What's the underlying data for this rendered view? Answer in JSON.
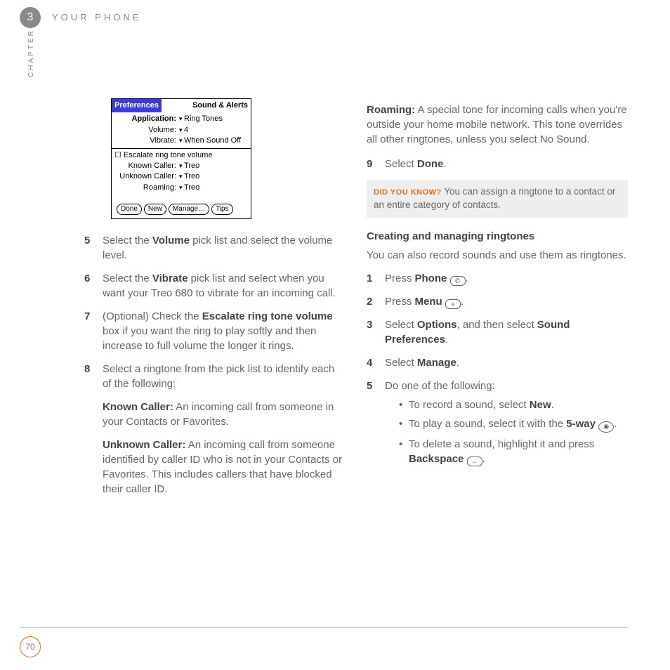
{
  "header": {
    "chapter_number": "3",
    "title": "YOUR PHONE",
    "side_label": "CHAPTER"
  },
  "prefs": {
    "tab": "Preferences",
    "category": "Sound & Alerts",
    "rows1": [
      {
        "label": "Application:",
        "value": "Ring Tones",
        "bold": true
      },
      {
        "label": "Volume:",
        "value": "4"
      },
      {
        "label": "Vibrate:",
        "value": "When Sound Off"
      }
    ],
    "checkbox": "Escalate ring tone volume",
    "rows2": [
      {
        "label": "Known Caller:",
        "value": "Treo"
      },
      {
        "label": "Unknown Caller:",
        "value": "Treo"
      },
      {
        "label": "Roaming:",
        "value": "Treo"
      }
    ],
    "buttons": [
      "Done",
      "New",
      "Manage…",
      "Tips"
    ]
  },
  "left_steps": [
    {
      "n": "5",
      "pre": "Select the ",
      "b": "Volume",
      "post": " pick list and select the volume level."
    },
    {
      "n": "6",
      "pre": "Select the ",
      "b": "Vibrate",
      "post": " pick list and select when you want your Treo 680 to vibrate for an incoming call."
    },
    {
      "n": "7",
      "pre": "(Optional)  Check the ",
      "b": "Escalate ring tone volume",
      "post": " box if you want the ring to play softly and then increase to full volume the longer it rings."
    },
    {
      "n": "8",
      "pre": "Select a ringtone from the pick list to identify each of the following:",
      "b": "",
      "post": ""
    }
  ],
  "defs": [
    {
      "term": "Known Caller:",
      "text": " An incoming call from someone in your Contacts or Favorites."
    },
    {
      "term": "Unknown Caller:",
      "text": " An incoming call from someone identified by caller ID who is not in your Contacts or Favorites. This includes callers that have blocked their caller ID."
    }
  ],
  "right": {
    "roaming_term": "Roaming:",
    "roaming_text": " A special tone for incoming calls when you're outside your home mobile network. This tone overrides all other ringtones, unless you select No Sound.",
    "step9_n": "9",
    "step9_pre": "Select ",
    "step9_b": "Done",
    "step9_post": ".",
    "callout_lead": "DID YOU KNOW?",
    "callout_text": "  You can assign a ringtone to a contact or an entire category of contacts.",
    "section_title": "Creating and managing ringtones",
    "section_intro": "You can also record sounds and use them as ringtones.",
    "steps": [
      {
        "n": "1",
        "pre": "Press ",
        "b": "Phone",
        "post": " ",
        "icon": "phone-icon",
        "tail": "."
      },
      {
        "n": "2",
        "pre": "Press ",
        "b": "Menu",
        "post": " ",
        "icon": "menu-icon",
        "tail": "."
      },
      {
        "n": "3",
        "pre": "Select ",
        "b": "Options",
        "post": ", and then select ",
        "b2": "Sound Preferences",
        "tail": "."
      },
      {
        "n": "4",
        "pre": "Select ",
        "b": "Manage",
        "post": "",
        "tail": "."
      },
      {
        "n": "5",
        "pre": "Do one of the following:",
        "b": "",
        "post": "",
        "tail": ""
      }
    ],
    "bullets": [
      {
        "pre": "To record a sound, select ",
        "b": "New",
        "post": "."
      },
      {
        "pre": "To play a sound, select it with the ",
        "b": "5-way",
        "post": " ",
        "icon": "5way-icon",
        "tail": "."
      },
      {
        "pre": "To delete a sound, highlight it and press ",
        "b": "Backspace",
        "post": " ",
        "icon": "backspace-icon",
        "tail": "."
      }
    ]
  },
  "page_number": "70"
}
